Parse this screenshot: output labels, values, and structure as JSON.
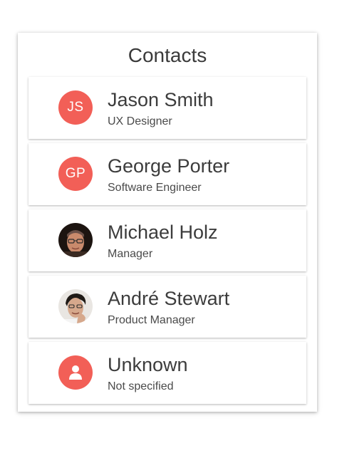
{
  "header": {
    "title": "Contacts"
  },
  "contacts": [
    {
      "name": "Jason Smith",
      "role": "UX Designer",
      "initials": "JS",
      "avatar_type": "initials"
    },
    {
      "name": "George Porter",
      "role": "Software Engineer",
      "initials": "GP",
      "avatar_type": "initials"
    },
    {
      "name": "Michael Holz",
      "role": "Manager",
      "avatar_type": "photo"
    },
    {
      "name": "André Stewart",
      "role": "Product Manager",
      "avatar_type": "photo"
    },
    {
      "name": "Unknown",
      "role": "Not specified",
      "avatar_type": "person-icon"
    }
  ],
  "colors": {
    "avatar_accent": "#f25f57"
  }
}
